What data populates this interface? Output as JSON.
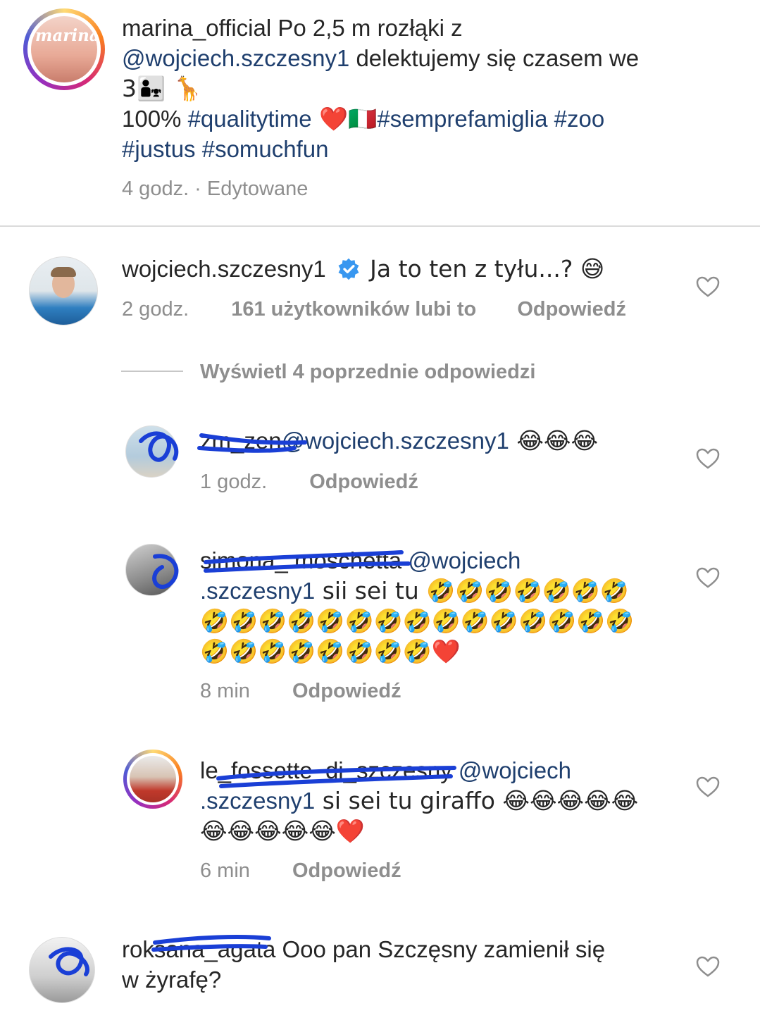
{
  "post": {
    "username": "marina_official",
    "caption_1": "Po 2,5 m rozłąki z",
    "mention": "@wojciech.szczesny1",
    "caption_2": " delektujemy się czasem we",
    "caption_3": "3👨‍👧 🦒",
    "caption_4_text": "100% ",
    "caption_4_tag1": "#qualitytime",
    "caption_4_emoji": " ❤️🇮🇹",
    "caption_4_tag2": "#semprefamiglia #zoo",
    "caption_5": "#justus #somuchfun",
    "meta": "4 godz. · Edytowane",
    "avatar_label": "marina"
  },
  "comments": [
    {
      "username": "wojciech.szczesny1",
      "verified": true,
      "text": "Ja to ten z tyłu...? 😅",
      "time": "2 godz.",
      "likes": "161 użytkowników lubi to",
      "reply": "Odpowiedź"
    }
  ],
  "view_replies": "Wyświetl 4 poprzednie odpowiedzi",
  "replies": [
    {
      "username": "zm_zen",
      "mention": "@wojciech.szczesny1",
      "text": " 😂😂😂",
      "time": "1 godz.",
      "reply": "Odpowiedź"
    },
    {
      "username": "simona_.moschetta",
      "mention": "@wojciech",
      "mention2": ".szczesny1",
      "text_line1": " sii sei tu 🤣🤣🤣🤣🤣🤣🤣",
      "text_line2": "🤣🤣🤣🤣🤣🤣🤣🤣🤣🤣🤣🤣🤣🤣🤣",
      "text_line3": "🤣🤣🤣🤣🤣🤣🤣🤣❤️",
      "time": "8 min",
      "reply": "Odpowiedź"
    },
    {
      "username": "le_fossette_di_szczesny",
      "mention": "@wojciech",
      "mention2": ".szczesny1",
      "text_line1": " si sei tu giraffo 😂😂😂😂😂",
      "text_line2": "😂😂😂😂😂❤️",
      "time": "6 min",
      "reply": "Odpowiedź"
    }
  ],
  "last_comment": {
    "username": "roksana_agata",
    "text_line1": " Ooo pan Szczęsny zamienił się",
    "text_line2": "w żyrafę?"
  },
  "colors": {
    "link": "#1f3f6e",
    "meta": "#8e8e8e",
    "scribble": "#1a3fd6",
    "verified": "#3897f0",
    "heart_outline": "#8e8e8e"
  }
}
